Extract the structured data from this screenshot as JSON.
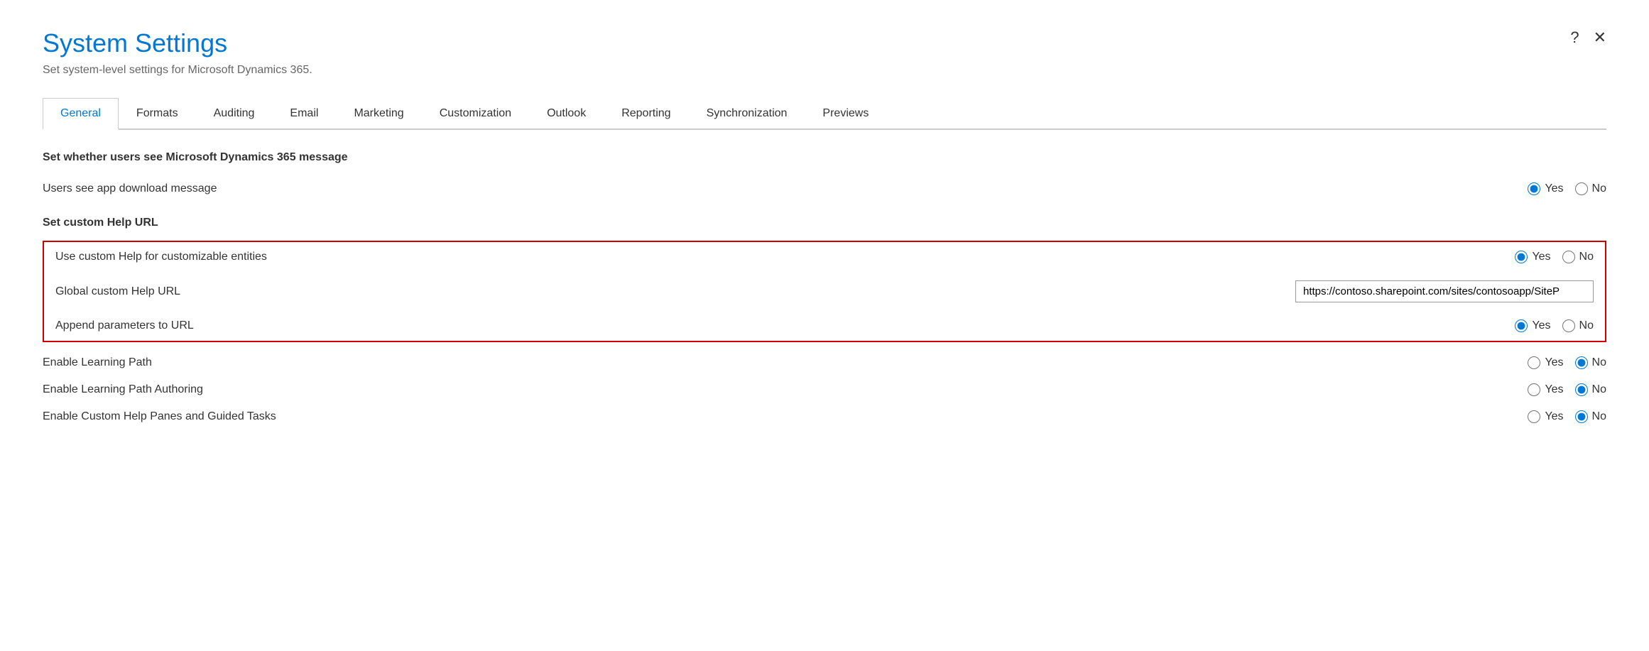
{
  "dialog": {
    "title": "System Settings",
    "subtitle": "Set system-level settings for Microsoft Dynamics 365.",
    "help_icon": "?",
    "close_icon": "✕"
  },
  "tabs": [
    {
      "id": "general",
      "label": "General",
      "active": true
    },
    {
      "id": "formats",
      "label": "Formats",
      "active": false
    },
    {
      "id": "auditing",
      "label": "Auditing",
      "active": false
    },
    {
      "id": "email",
      "label": "Email",
      "active": false
    },
    {
      "id": "marketing",
      "label": "Marketing",
      "active": false
    },
    {
      "id": "customization",
      "label": "Customization",
      "active": false
    },
    {
      "id": "outlook",
      "label": "Outlook",
      "active": false
    },
    {
      "id": "reporting",
      "label": "Reporting",
      "active": false
    },
    {
      "id": "synchronization",
      "label": "Synchronization",
      "active": false
    },
    {
      "id": "previews",
      "label": "Previews",
      "active": false
    }
  ],
  "sections": [
    {
      "id": "microsoft-message",
      "heading": "Set whether users see Microsoft Dynamics 365 message",
      "rows": [
        {
          "id": "app-download-message",
          "label": "Users see app download message",
          "control_type": "radio",
          "highlighted": false,
          "yes_selected": true,
          "no_selected": false
        }
      ]
    },
    {
      "id": "custom-help-url",
      "heading": "Set custom Help URL",
      "highlighted_group": true,
      "rows": [
        {
          "id": "use-custom-help",
          "label": "Use custom Help for customizable entities",
          "control_type": "radio",
          "yes_selected": true,
          "no_selected": false
        },
        {
          "id": "global-custom-help-url",
          "label": "Global custom Help URL",
          "control_type": "text",
          "value": "https://contoso.sharepoint.com/sites/contosoapp/SiteP"
        },
        {
          "id": "append-parameters",
          "label": "Append parameters to URL",
          "control_type": "radio",
          "yes_selected": true,
          "no_selected": false
        }
      ]
    },
    {
      "id": "learning-path",
      "heading": "",
      "rows": [
        {
          "id": "enable-learning-path",
          "label": "Enable Learning Path",
          "control_type": "radio",
          "yes_selected": false,
          "no_selected": true
        },
        {
          "id": "enable-learning-path-authoring",
          "label": "Enable Learning Path Authoring",
          "control_type": "radio",
          "yes_selected": false,
          "no_selected": true
        },
        {
          "id": "enable-custom-help-panes",
          "label": "Enable Custom Help Panes and Guided Tasks",
          "control_type": "radio",
          "yes_selected": false,
          "no_selected": true
        }
      ]
    }
  ],
  "labels": {
    "yes": "Yes",
    "no": "No"
  }
}
